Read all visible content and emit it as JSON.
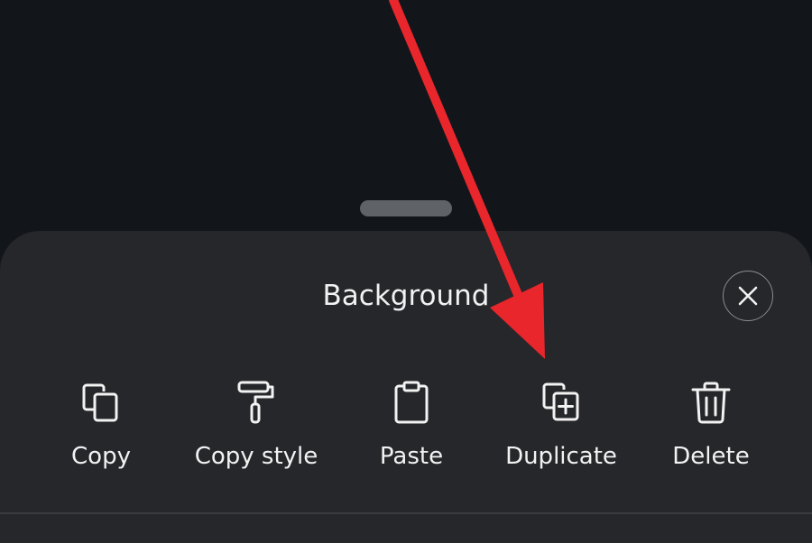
{
  "sheet": {
    "title": "Background",
    "close_icon": "close-icon"
  },
  "actions": [
    {
      "label": "Copy",
      "icon": "copy-icon"
    },
    {
      "label": "Copy style",
      "icon": "paint-roller-icon"
    },
    {
      "label": "Paste",
      "icon": "clipboard-icon"
    },
    {
      "label": "Duplicate",
      "icon": "duplicate-icon"
    },
    {
      "label": "Delete",
      "icon": "trash-icon"
    }
  ],
  "annotation": {
    "arrow_color": "#e8262b",
    "points_to": "Duplicate"
  },
  "colors": {
    "background": "#12161b",
    "sheet": "#26272b",
    "text": "#f2f2f2"
  }
}
